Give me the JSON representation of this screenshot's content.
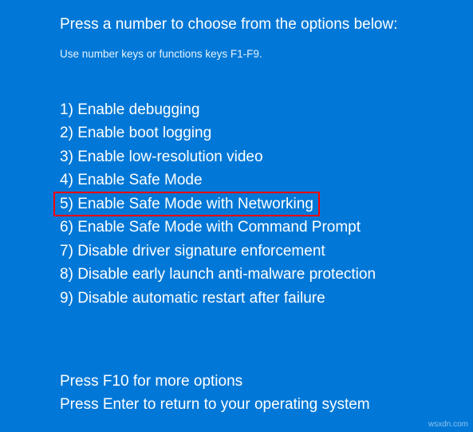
{
  "title": "Press a number to choose from the options below:",
  "subtitle": "Use number keys or functions keys F1-F9.",
  "options": [
    {
      "num": "1)",
      "label": "Enable debugging",
      "highlighted": false
    },
    {
      "num": "2)",
      "label": "Enable boot logging",
      "highlighted": false
    },
    {
      "num": "3)",
      "label": "Enable low-resolution video",
      "highlighted": false
    },
    {
      "num": "4)",
      "label": "Enable Safe Mode",
      "highlighted": false
    },
    {
      "num": "5)",
      "label": "Enable Safe Mode with Networking",
      "highlighted": true
    },
    {
      "num": "6)",
      "label": "Enable Safe Mode with Command Prompt",
      "highlighted": false
    },
    {
      "num": "7)",
      "label": "Disable driver signature enforcement",
      "highlighted": false
    },
    {
      "num": "8)",
      "label": "Disable early launch anti-malware protection",
      "highlighted": false
    },
    {
      "num": "9)",
      "label": "Disable automatic restart after failure",
      "highlighted": false
    }
  ],
  "footer": {
    "line1": "Press F10 for more options",
    "line2": "Press Enter to return to your operating system"
  },
  "watermark": "wsxdn.com"
}
